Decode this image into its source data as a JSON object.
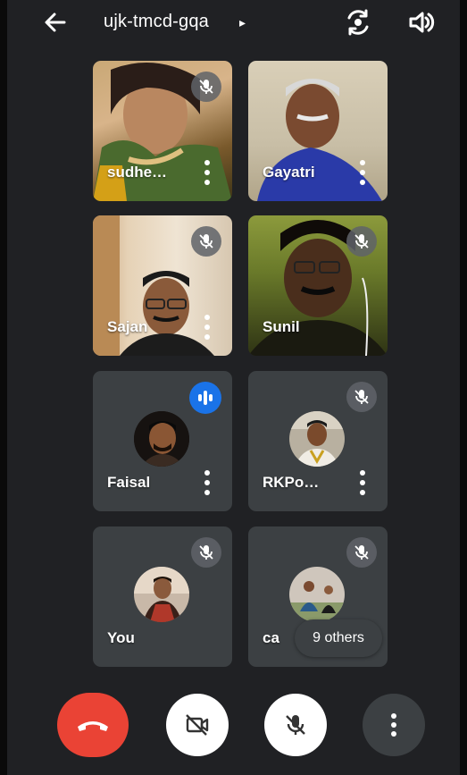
{
  "header": {
    "meeting_code": "ujk-tmcd-gqa",
    "caret": "▸"
  },
  "participants": [
    {
      "name": "sudhe…",
      "muted": true,
      "video": true
    },
    {
      "name": "Gayatri",
      "muted": false,
      "video": true
    },
    {
      "name": "Sajan",
      "muted": true,
      "video": true
    },
    {
      "name": "Sunil",
      "muted": true,
      "video": true
    },
    {
      "name": "Faisal",
      "muted": false,
      "speaking": true,
      "video": false
    },
    {
      "name": "RKPo…",
      "muted": true,
      "video": false
    },
    {
      "name": "You",
      "muted": true,
      "video": false
    },
    {
      "name": "ca",
      "muted": true,
      "video": false
    }
  ],
  "others_chip": "9 others",
  "colors": {
    "background": "#202124",
    "tile": "#3c4043",
    "end_call": "#ea4335",
    "speaking": "#1a73e8"
  }
}
